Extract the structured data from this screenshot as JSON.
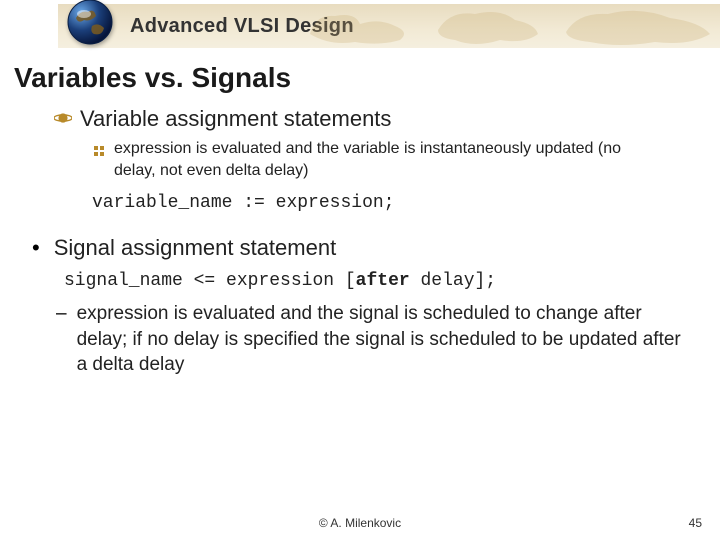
{
  "header": {
    "title": "Advanced VLSI Design"
  },
  "slide": {
    "title": "Variables vs. Signals"
  },
  "section1": {
    "heading": "Variable assignment statements",
    "sub1": "expression is evaluated and the variable is instantaneously updated (no delay, not even delta delay)",
    "code_lhs": "variable_name",
    "code_op": " := ",
    "code_rhs": "expression;"
  },
  "section2": {
    "heading": "Signal assignment statement",
    "code_lhs": "signal_name",
    "code_op": " <= ",
    "code_mid": "expression [",
    "code_kw": "after",
    "code_end": " delay];",
    "sub1": "expression is evaluated and the signal is scheduled to change after delay; if no delay is specified the signal is scheduled to be updated after a delta delay"
  },
  "footer": {
    "copyright": "© A. Milenkovic",
    "page": "45"
  }
}
